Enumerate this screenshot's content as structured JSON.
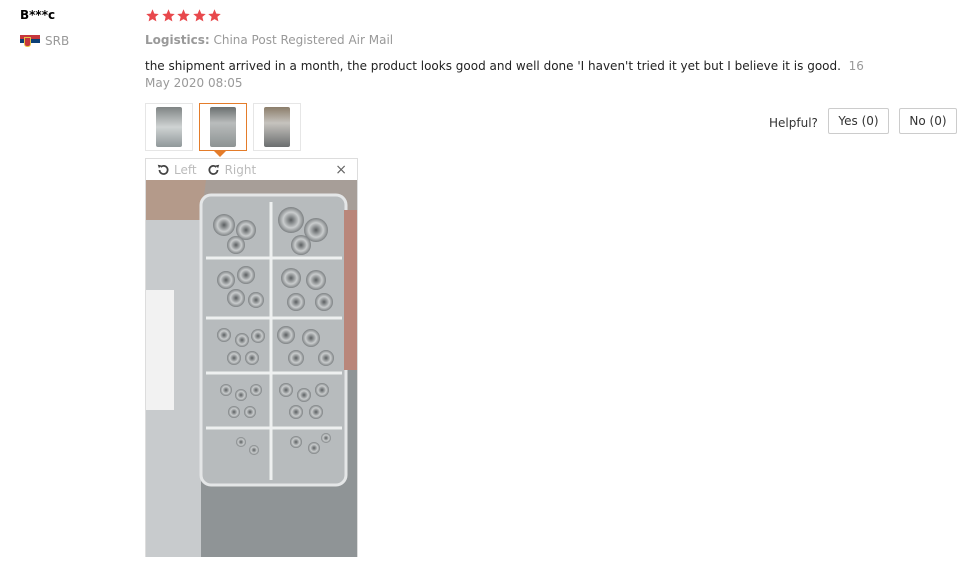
{
  "review": {
    "user_name": "B***c",
    "country_code": "SRB",
    "rating": 5,
    "logistics_label": "Logistics:",
    "logistics_value": "China Post Registered Air Mail",
    "text": "the shipment arrived in a month, the product looks good and well done 'I haven't tried it yet but I believe it is good.",
    "date": "16 May 2020 08:05"
  },
  "colors": {
    "star": "#e8484c",
    "active_thumb": "#e47c2a",
    "muted_text": "#999999"
  },
  "viewer": {
    "rotate_left_label": "Left",
    "rotate_right_label": "Right",
    "close_symbol": "×"
  },
  "helpful": {
    "label": "Helpful?",
    "yes_label": "Yes (0)",
    "no_label": "No (0)"
  }
}
